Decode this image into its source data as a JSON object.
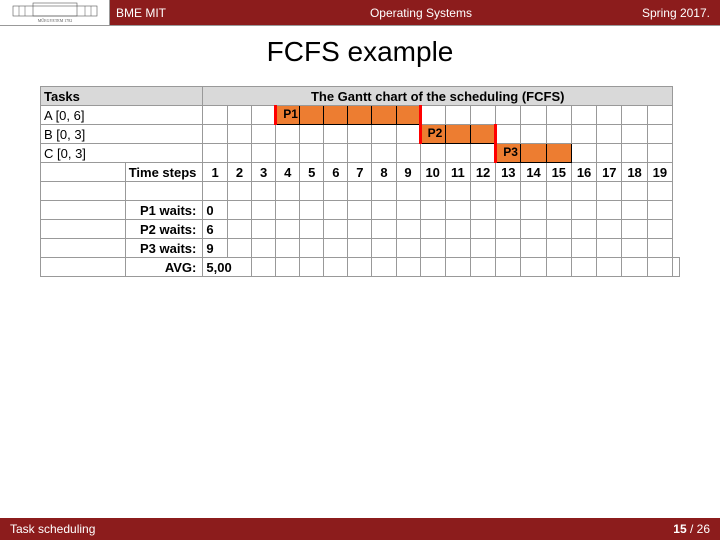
{
  "header": {
    "org": "BME MIT",
    "course": "Operating Systems",
    "term": "Spring 2017."
  },
  "title": "FCFS example",
  "table": {
    "tasks_header": "Tasks",
    "gantt_header": "The Gantt chart of the scheduling (FCFS)",
    "tasks": [
      "A [0, 6]",
      "B [0, 3]",
      "C [0, 3]"
    ],
    "proc_labels": [
      "P1",
      "P2",
      "P3"
    ],
    "time_label": "Time steps",
    "steps": [
      "1",
      "2",
      "3",
      "4",
      "5",
      "6",
      "7",
      "8",
      "9",
      "10",
      "11",
      "12",
      "13",
      "14",
      "15",
      "16",
      "17",
      "18",
      "19"
    ],
    "waits": [
      {
        "label": "P1 waits:",
        "value": "0"
      },
      {
        "label": "P2 waits:",
        "value": "6"
      },
      {
        "label": "P3 waits:",
        "value": "9"
      }
    ],
    "avg_label": "AVG:",
    "avg_value": "5,00"
  },
  "chart_data": {
    "type": "bar",
    "title": "FCFS Gantt chart",
    "xlabel": "Time steps",
    "series": [
      {
        "name": "P1",
        "task": "A [0, 6]",
        "start": 0,
        "end": 6
      },
      {
        "name": "P2",
        "task": "B [0, 3]",
        "start": 6,
        "end": 9
      },
      {
        "name": "P3",
        "task": "C [0, 3]",
        "start": 9,
        "end": 12
      }
    ],
    "waits": {
      "P1": 0,
      "P2": 6,
      "P3": 9
    },
    "avg_wait": 5.0,
    "xlim": [
      1,
      19
    ]
  },
  "footer": {
    "topic": "Task scheduling",
    "page": "15",
    "total": "26"
  }
}
